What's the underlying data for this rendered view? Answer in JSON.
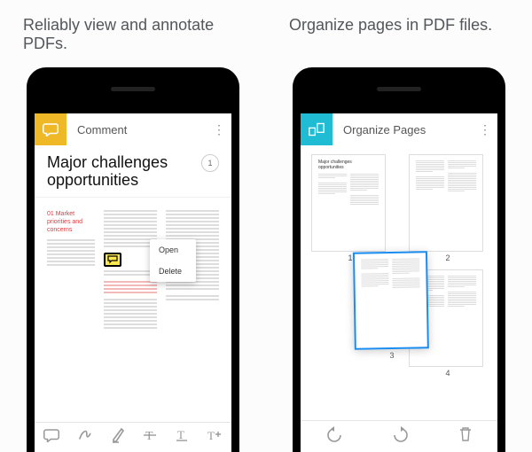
{
  "captions": {
    "left": "Reliably view and annotate PDFs.",
    "right": "Organize pages in PDF files."
  },
  "comment_screen": {
    "toolbar_title": "Comment",
    "doc_title_line1": "Major challenges",
    "doc_title_line2": "opportunities",
    "page_number": "1",
    "section_heading": "01 Market priorities and concerns",
    "context_menu": {
      "open": "Open",
      "delete": "Delete"
    },
    "bottom_tools": [
      "speech-bubble-icon",
      "freehand-icon",
      "highlight-icon",
      "strikethrough-icon",
      "underline-icon",
      "add-text-icon"
    ]
  },
  "organize_screen": {
    "toolbar_title": "Organize Pages",
    "thumb_doc_title": "Major challenges opportunities",
    "page_labels": [
      "1",
      "2",
      "3",
      "4"
    ],
    "bottom_tools": [
      "rotate-left-icon",
      "rotate-right-icon",
      "delete-icon"
    ]
  },
  "colors": {
    "yellow": "#efb827",
    "teal": "#20bcd4"
  }
}
